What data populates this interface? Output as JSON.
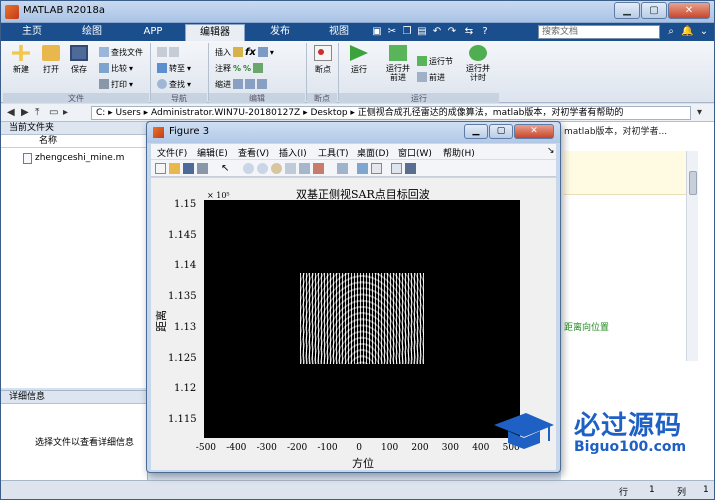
{
  "window": {
    "title": "MATLAB R2018a"
  },
  "tabs": [
    {
      "label": "主页"
    },
    {
      "label": "绘图"
    },
    {
      "label": "APP"
    },
    {
      "label": "编辑器"
    },
    {
      "label": "发布"
    },
    {
      "label": "视图"
    }
  ],
  "search": {
    "placeholder": "搜索文档"
  },
  "toolstrip": {
    "new": "新建",
    "open": "打开",
    "save": "保存",
    "find_files": "查找文件",
    "compare": "比较",
    "print": "打印",
    "goto": "转至",
    "find": "查找",
    "insert": "插入",
    "comment": "注释",
    "indent": "缩进",
    "breakpoints": "断点",
    "run": "运行",
    "run_advance": "运行并\n前进",
    "run_section": "运行节",
    "advance": "前进",
    "run_time": "运行并\n计时",
    "groups": {
      "file": "文件",
      "nav": "导航",
      "edit": "编辑",
      "bp": "断点",
      "run": "运行"
    }
  },
  "address": {
    "path": "C: ▸ Users ▸ Administrator.WIN7U-20180127Z ▸ Desktop ▸ 正侧视合成孔径雷达的成像算法，matlab版本，对初学者有帮助的"
  },
  "left_panel": {
    "header": "当前文件夹",
    "column": "名称",
    "files": [
      {
        "name": "zhengceshi_mine.m"
      }
    ],
    "detail_header": "详细信息",
    "detail_msg": "选择文件以查看详细信息"
  },
  "editor": {
    "tab_text": "matlab版本，对初学者...",
    "green_text": "距离向位置"
  },
  "status": {
    "row_label": "行",
    "row_value": "1",
    "col_label": "列",
    "col_value": "1"
  },
  "figure": {
    "title": "Figure 3",
    "menus": [
      "文件(F)",
      "编辑(E)",
      "查看(V)",
      "插入(I)",
      "工具(T)",
      "桌面(D)",
      "窗口(W)",
      "帮助(H)"
    ]
  },
  "chart_data": {
    "type": "heatmap",
    "title": "双基正侧视SAR点目标回波",
    "xlabel": "方位",
    "ylabel": "距离",
    "x_ticks": [
      "-500",
      "-400",
      "-300",
      "-200",
      "-100",
      "0",
      "100",
      "200",
      "300",
      "400",
      "500"
    ],
    "y_ticks": [
      "1.15",
      "1.145",
      "1.14",
      "1.135",
      "1.13",
      "1.125",
      "1.12",
      "1.115"
    ],
    "y_exponent": "× 10⁵",
    "xlim": [
      -500,
      500
    ],
    "ylim": [
      111300,
      115000
    ],
    "background_color": "#000000"
  },
  "watermark": {
    "cn": "必过源码",
    "en": "Biguo100.com"
  }
}
